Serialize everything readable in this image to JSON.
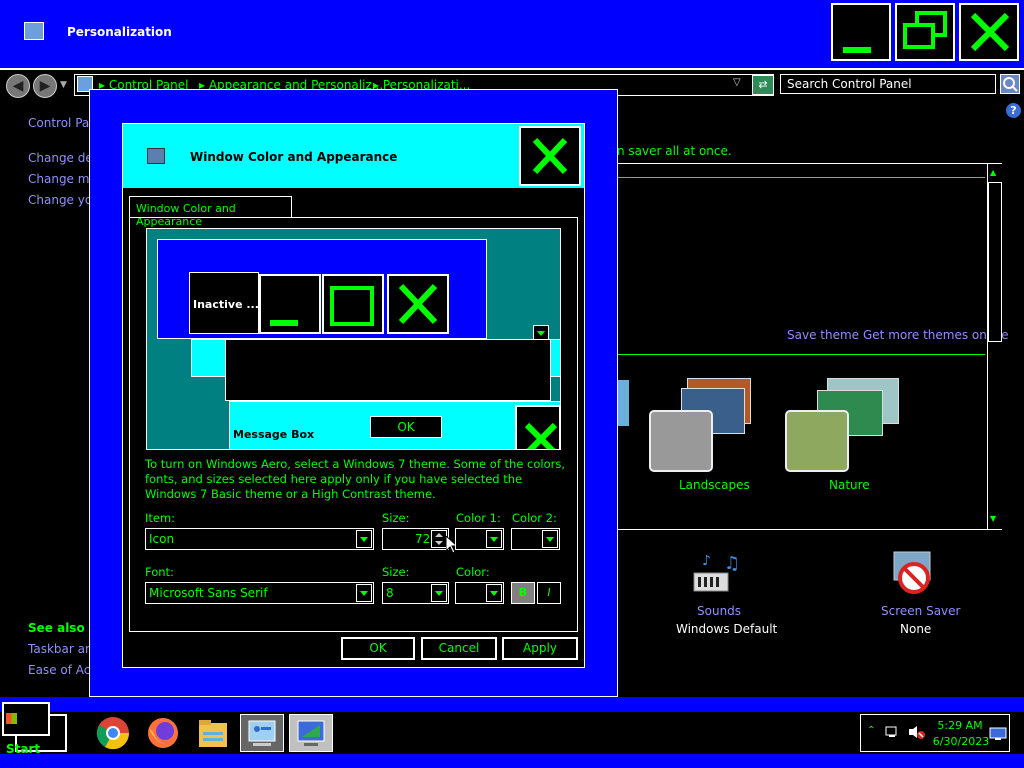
{
  "window": {
    "title": "Personalization"
  },
  "address_bar": {
    "crumb1": "Control Panel",
    "crumb2": "Appearance and Personaliz...",
    "crumb3": "Personalizati...",
    "search_placeholder": "Search Control Panel"
  },
  "left_pane": {
    "home_link": "Control Pane",
    "links": [
      "Change desk",
      "Change mous",
      "Change your"
    ],
    "see_also_heading": "See also",
    "see_also_links": [
      "Taskbar and",
      "Ease of Acce"
    ]
  },
  "main": {
    "intro_tail": "n saver all at once.",
    "save_theme": "Save theme",
    "get_more_themes": "Get more themes online",
    "themes": [
      {
        "name": "Landscapes"
      },
      {
        "name": "Nature"
      }
    ],
    "bottom_items": [
      {
        "title": "Sounds",
        "subtitle": "Windows Default"
      },
      {
        "title": "Screen Saver",
        "subtitle": "None"
      }
    ]
  },
  "dialog": {
    "title": "Window Color and Appearance",
    "tab_label": "Window Color and Appearance",
    "preview": {
      "inactive_title": "Inactive ...",
      "message_box_title": "Message Box",
      "ok_label": "OK"
    },
    "description": "To turn on Windows Aero, select a Windows 7 theme.  Some of the colors, fonts, and sizes selected here apply only if you have selected the Windows 7 Basic theme or a High Contrast theme.",
    "item_label": "Item:",
    "item_value": "Icon",
    "size_label": "Size:",
    "size_value": "72",
    "color1_label": "Color 1:",
    "color2_label": "Color 2:",
    "font_label": "Font:",
    "font_value": "Microsoft Sans Serif",
    "font_size_label": "Size:",
    "font_size_value": "8",
    "font_color_label": "Color:",
    "bold_label": "B",
    "italic_label": "I",
    "ok_button": "OK",
    "cancel_button": "Cancel",
    "apply_button": "Apply"
  },
  "taskbar": {
    "start_label": "Start",
    "clock_time": "5:29 AM",
    "clock_date": "6/30/2023"
  },
  "colors": {
    "accent_blue": "#0000ff",
    "accent_green": "#00ff00",
    "cyan": "#00ffff",
    "teal": "#008080",
    "link": "#8f8fff"
  }
}
